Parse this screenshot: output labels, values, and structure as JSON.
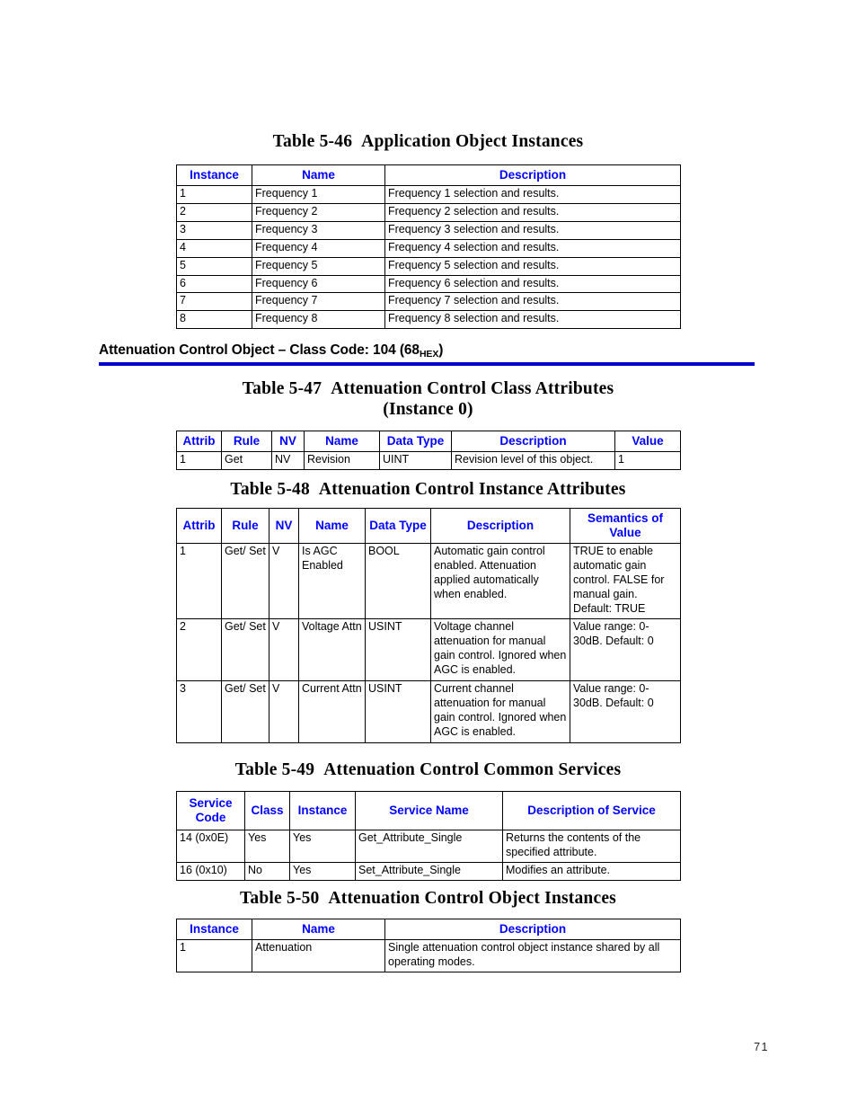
{
  "document": {
    "page_number": "71",
    "header_text_color": "#0000FF",
    "rule_color": "#0000CC"
  },
  "table_5_46": {
    "caption_number": "Table 5-46",
    "caption_title": "Application Object Instances",
    "columns": [
      "Instance",
      "Name",
      "Description"
    ],
    "rows": [
      [
        "1",
        "Frequency 1",
        "Frequency 1 selection and results."
      ],
      [
        "2",
        "Frequency 2",
        "Frequency 2 selection and results."
      ],
      [
        "3",
        "Frequency 3",
        "Frequency 3 selection and results."
      ],
      [
        "4",
        "Frequency 4",
        "Frequency 4 selection and results."
      ],
      [
        "5",
        "Frequency 5",
        "Frequency 5 selection and results."
      ],
      [
        "6",
        "Frequency 6",
        "Frequency 6 selection and results."
      ],
      [
        "7",
        "Frequency 7",
        "Frequency 7 selection and results."
      ],
      [
        "8",
        "Frequency 8",
        "Frequency 8 selection and results."
      ]
    ]
  },
  "section_heading": {
    "text_before": "Attenuation Control Object – Class Code: 104 (68",
    "subscript": "HEX",
    "text_after": ")"
  },
  "table_5_47": {
    "caption_number": "Table 5-47",
    "caption_title": "Attenuation Control Class Attributes",
    "caption_line2": "(Instance 0)",
    "columns": [
      "Attrib",
      "Rule",
      "NV",
      "Name",
      "Data Type",
      "Description",
      "Value"
    ],
    "rows": [
      [
        "1",
        "Get",
        "NV",
        "Revision",
        "UINT",
        "Revision level of this object.",
        "1"
      ]
    ]
  },
  "table_5_48": {
    "caption_number": "Table 5-48",
    "caption_title": "Attenuation Control Instance Attributes",
    "columns": [
      "Attrib",
      "Rule",
      "NV",
      "Name",
      "Data Type",
      "Description",
      "Semantics of Value"
    ],
    "rows": [
      [
        "1",
        "Get/ Set",
        "V",
        "Is AGC Enabled",
        "BOOL",
        "Automatic gain control enabled. Attenuation applied automatically when enabled.",
        "TRUE to enable automatic gain control. FALSE for manual gain. Default: TRUE"
      ],
      [
        "2",
        "Get/ Set",
        "V",
        "Voltage Attn",
        "USINT",
        "Voltage channel attenuation for manual gain control. Ignored when AGC is enabled.",
        "Value range: 0-30dB. Default: 0"
      ],
      [
        "3",
        "Get/ Set",
        "V",
        "Current Attn",
        "USINT",
        "Current channel attenuation for manual gain control. Ignored when AGC is enabled.",
        "Value range: 0-30dB. Default: 0"
      ]
    ]
  },
  "table_5_49": {
    "caption_number": "Table 5-49",
    "caption_title": "Attenuation Control Common Services",
    "columns": [
      "Service Code",
      "Class",
      "Instance",
      "Service Name",
      "Description of Service"
    ],
    "rows": [
      [
        "14 (0x0E)",
        "Yes",
        "Yes",
        "Get_Attribute_Single",
        "Returns the contents of the specified attribute."
      ],
      [
        "16 (0x10)",
        "No",
        "Yes",
        "Set_Attribute_Single",
        "Modifies an attribute."
      ]
    ]
  },
  "table_5_50": {
    "caption_number": "Table 5-50",
    "caption_title": "Attenuation Control Object Instances",
    "columns": [
      "Instance",
      "Name",
      "Description"
    ],
    "rows": [
      [
        "1",
        "Attenuation",
        "Single attenuation control object instance shared by all operating modes."
      ]
    ]
  }
}
